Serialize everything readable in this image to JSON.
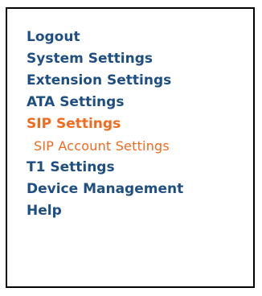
{
  "nav": {
    "items": [
      {
        "label": "Logout",
        "state": "normal"
      },
      {
        "label": "System Settings",
        "state": "normal"
      },
      {
        "label": "Extension Settings",
        "state": "normal"
      },
      {
        "label": "ATA Settings",
        "state": "normal"
      },
      {
        "label": "SIP Settings",
        "state": "active"
      },
      {
        "label": "SIP Account Settings",
        "state": "active-sub"
      },
      {
        "label": "T1 Settings",
        "state": "normal"
      },
      {
        "label": "Device Management",
        "state": "normal"
      },
      {
        "label": "Help",
        "state": "normal"
      }
    ]
  },
  "colors": {
    "link": "#1f4f82",
    "active": "#f16a1e",
    "border": "#000000",
    "background": "#ffffff"
  }
}
